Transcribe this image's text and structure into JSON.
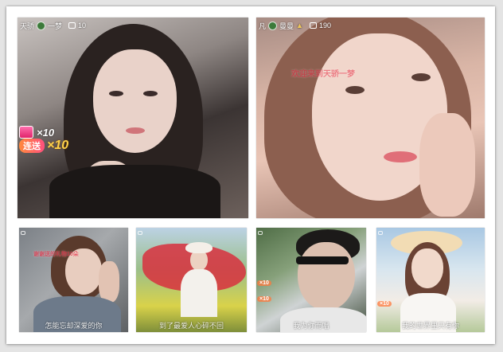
{
  "streams": [
    {
      "host": "天骄",
      "host_suffix": "一梦",
      "viewers": "10",
      "gift_count": "×10",
      "combo_label": "连送",
      "combo_count": "×10"
    },
    {
      "host": "凡",
      "host_suffix": "曼曼",
      "viewers": "190",
      "ticker": "欢迎来到天骄一梦"
    },
    {
      "ticker": "谢谢送的礼物10朵",
      "caption": "怎能忘却深爱的你"
    },
    {
      "caption": "到了最爱人心碎不回"
    },
    {
      "gift_a": "×10",
      "gift_b": "×10",
      "caption": "我为你而唱"
    },
    {
      "gift_a": "×10",
      "caption": "我的世界里只有你"
    }
  ],
  "colors": {
    "ticker_red": "#e8334a",
    "combo_gold": "#ffd24a",
    "gift_pink": "#e0246a"
  }
}
